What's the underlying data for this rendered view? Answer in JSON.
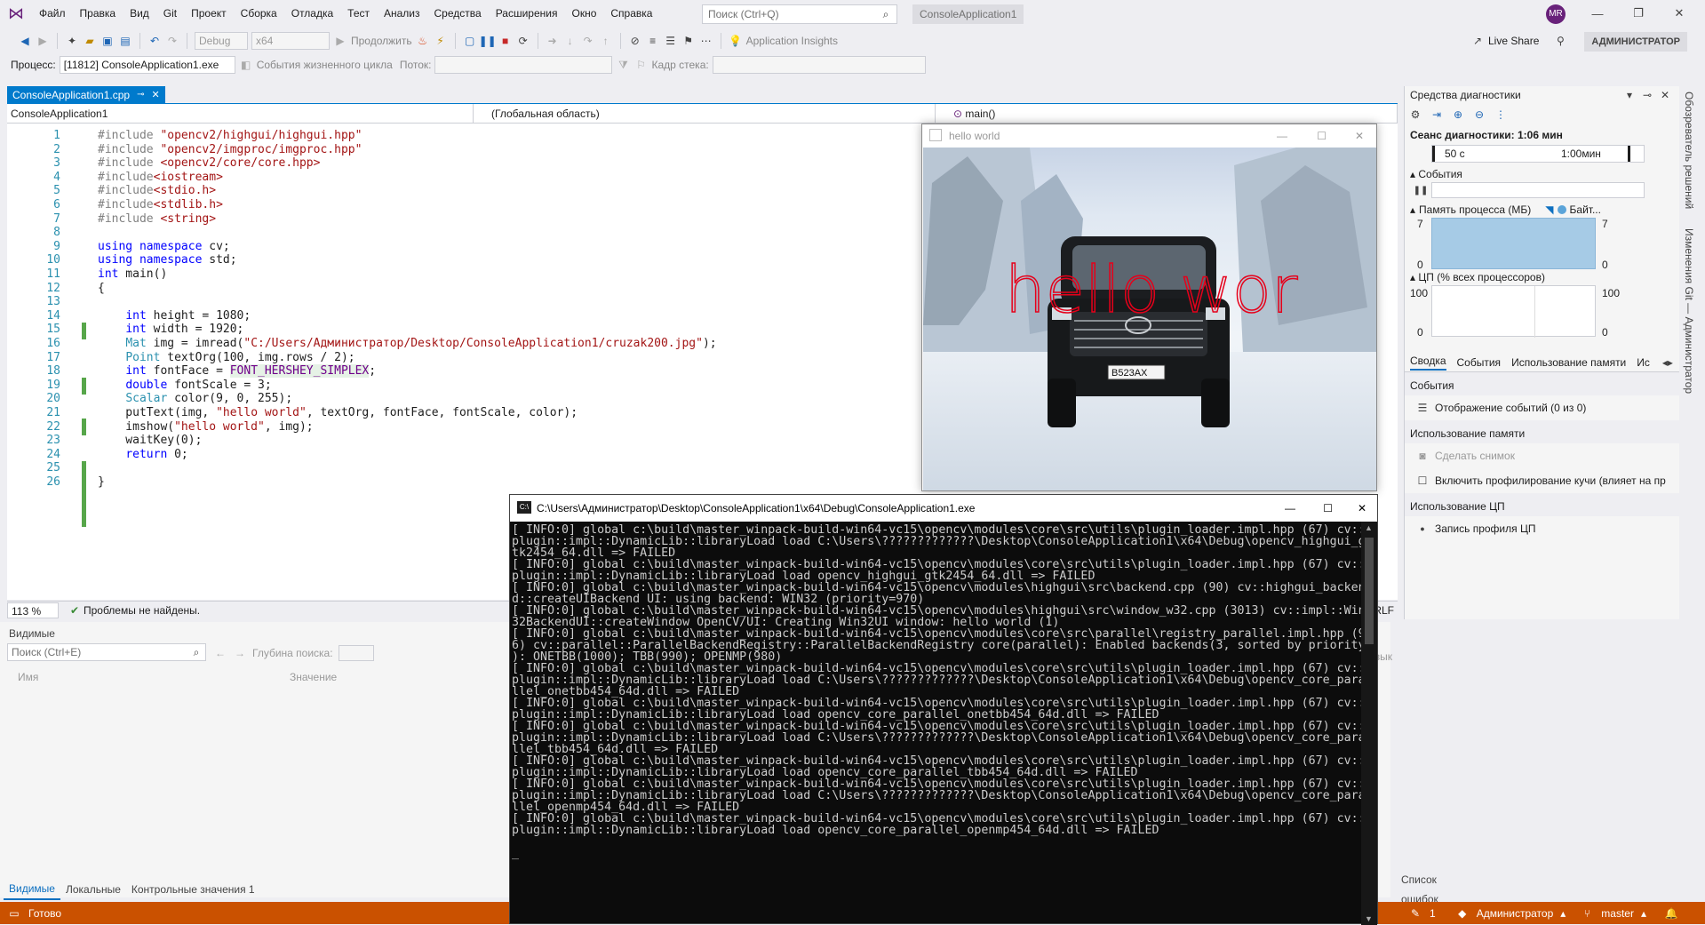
{
  "menubar": {
    "items": [
      "Файл",
      "Правка",
      "Вид",
      "Git",
      "Проект",
      "Сборка",
      "Отладка",
      "Тест",
      "Анализ",
      "Средства",
      "Расширения",
      "Окно",
      "Справка"
    ],
    "search_placeholder": "Поиск (Ctrl+Q)",
    "solution_name": "ConsoleApplication1",
    "avatar": "MR"
  },
  "toolbar": {
    "config": "Debug",
    "platform": "x64",
    "continue_label": "Продолжить",
    "app_insights": "Application Insights",
    "live_share": "Live Share",
    "admin": "АДМИНИСТРАТОР"
  },
  "debug_toolbar": {
    "process_label": "Процесс:",
    "process_value": "[11812] ConsoleApplication1.exe",
    "lifecycle_label": "События жизненного цикла",
    "thread_label": "Поток:",
    "stack_label": "Кадр стека:"
  },
  "editor": {
    "tab_label": "ConsoleApplication1.cpp",
    "nav_project": "ConsoleApplication1",
    "nav_scope": "(Глобальная область)",
    "nav_member": "main()",
    "zoom": "113 %",
    "issues": "Проблемы не найдены.",
    "line_ending": "RLF"
  },
  "code_lines": [
    "#include \"opencv2/highgui/highgui.hpp\"",
    "#include \"opencv2/imgproc/imgproc.hpp\"",
    "#include <opencv2/core/core.hpp>",
    "#include<iostream>",
    "#include<stdio.h>",
    "#include<stdlib.h>",
    "#include <string>",
    "",
    "using namespace cv;",
    "using namespace std;",
    "int main()",
    "{",
    "",
    "    int height = 1080;",
    "    int width = 1920;",
    "    Mat img = imread(\"C:/Users/Администратор/Desktop/ConsoleApplication1/cruzak200.jpg\");",
    "    Point textOrg(100, img.rows / 2);",
    "    int fontFace = FONT_HERSHEY_SIMPLEX;",
    "    double fontScale = 3;",
    "    Scalar color(9, 0, 255);",
    "    putText(img, \"hello world\", textOrg, fontFace, fontScale, color);",
    "    imshow(\"hello world\", img);",
    "    waitKey(0);",
    "    return 0;",
    "",
    "}"
  ],
  "watch": {
    "title": "Видимые",
    "search_placeholder": "Поиск (Ctrl+E)",
    "depth_label": "Глубина поиска:",
    "col_name": "Имя",
    "col_value": "Значение",
    "col_lang": "Язык",
    "tabs": [
      "Видимые",
      "Локальные",
      "Контрольные значения 1"
    ],
    "error_list": "Список ошибок"
  },
  "diagnostics": {
    "title": "Средства диагностики",
    "session": "Сеанс диагностики: 1:06 мин",
    "tick_50": "50 с",
    "tick_100": "1:00мин",
    "events": "События",
    "memory": "Память процесса (МБ)",
    "memory_legend": "Байт...",
    "mem_max": "7",
    "mem_min": "0",
    "cpu": "ЦП (% всех процессоров)",
    "cpu_max": "100",
    "cpu_min": "0",
    "tabs": [
      "Сводка",
      "События",
      "Использование памяти",
      "Ис"
    ],
    "sec_events": "События",
    "show_events": "Отображение событий (0 из 0)",
    "sec_memory": "Использование памяти",
    "snapshot": "Сделать снимок",
    "heap_profiling": "Включить профилирование кучи (влияет на пр",
    "sec_cpu": "Использование ЦП",
    "cpu_profile": "Запись профиля ЦП"
  },
  "vertical_tabs": [
    "Обозреватель решений",
    "Изменения Git — Администратор"
  ],
  "image_window": {
    "title": "hello world",
    "overlay_text": "hello wor",
    "plate": "В523АХ"
  },
  "console": {
    "title": "C:\\Users\\Администратор\\Desktop\\ConsoleApplication1\\x64\\Debug\\ConsoleApplication1.exe",
    "lines": [
      "[ INFO:0] global c:\\build\\master_winpack-build-win64-vc15\\opencv\\modules\\core\\src\\utils\\plugin_loader.impl.hpp (67) cv::",
      "plugin::impl::DynamicLib::libraryLoad load C:\\Users\\?????????????\\Desktop\\ConsoleApplication1\\x64\\Debug\\opencv_highgui_g",
      "tk2454_64.dll => FAILED",
      "[ INFO:0] global c:\\build\\master_winpack-build-win64-vc15\\opencv\\modules\\core\\src\\utils\\plugin_loader.impl.hpp (67) cv::",
      "plugin::impl::DynamicLib::libraryLoad load opencv_highgui_gtk2454_64.dll => FAILED",
      "[ INFO:0] global c:\\build\\master_winpack-build-win64-vc15\\opencv\\modules\\highgui\\src\\backend.cpp (90) cv::highgui_backen",
      "d::createUIBackend UI: using backend: WIN32 (priority=970)",
      "[ INFO:0] global c:\\build\\master_winpack-build-win64-vc15\\opencv\\modules\\highgui\\src\\window_w32.cpp (3013) cv::impl::Win",
      "32BackendUI::createWindow OpenCV/UI: Creating Win32UI window: hello world (1)",
      "[ INFO:0] global c:\\build\\master_winpack-build-win64-vc15\\opencv\\modules\\core\\src\\parallel\\registry_parallel.impl.hpp (9",
      "6) cv::parallel::ParallelBackendRegistry::ParallelBackendRegistry core(parallel): Enabled backends(3, sorted by priority",
      "): ONETBB(1000); TBB(990); OPENMP(980)",
      "[ INFO:0] global c:\\build\\master_winpack-build-win64-vc15\\opencv\\modules\\core\\src\\utils\\plugin_loader.impl.hpp (67) cv::",
      "plugin::impl::DynamicLib::libraryLoad load C:\\Users\\?????????????\\Desktop\\ConsoleApplication1\\x64\\Debug\\opencv_core_para",
      "llel_onetbb454_64d.dll => FAILED",
      "[ INFO:0] global c:\\build\\master_winpack-build-win64-vc15\\opencv\\modules\\core\\src\\utils\\plugin_loader.impl.hpp (67) cv::",
      "plugin::impl::DynamicLib::libraryLoad load opencv_core_parallel_onetbb454_64d.dll => FAILED",
      "[ INFO:0] global c:\\build\\master_winpack-build-win64-vc15\\opencv\\modules\\core\\src\\utils\\plugin_loader.impl.hpp (67) cv::",
      "plugin::impl::DynamicLib::libraryLoad load C:\\Users\\?????????????\\Desktop\\ConsoleApplication1\\x64\\Debug\\opencv_core_para",
      "llel_tbb454_64d.dll => FAILED",
      "[ INFO:0] global c:\\build\\master_winpack-build-win64-vc15\\opencv\\modules\\core\\src\\utils\\plugin_loader.impl.hpp (67) cv::",
      "plugin::impl::DynamicLib::libraryLoad load opencv_core_parallel_tbb454_64d.dll => FAILED",
      "[ INFO:0] global c:\\build\\master_winpack-build-win64-vc15\\opencv\\modules\\core\\src\\utils\\plugin_loader.impl.hpp (67) cv::",
      "plugin::impl::DynamicLib::libraryLoad load C:\\Users\\?????????????\\Desktop\\ConsoleApplication1\\x64\\Debug\\opencv_core_para",
      "llel_openmp454_64d.dll => FAILED",
      "[ INFO:0] global c:\\build\\master_winpack-build-win64-vc15\\opencv\\modules\\core\\src\\utils\\plugin_loader.impl.hpp (67) cv::",
      "plugin::impl::DynamicLib::libraryLoad load opencv_core_parallel_openmp454_64d.dll => FAILED",
      "",
      "_"
    ]
  },
  "statusbar": {
    "ready": "Готово",
    "errors": "1",
    "user": "Администратор",
    "branch": "master"
  },
  "colors": {
    "accent": "#007acc",
    "status_bg": "#ca5100",
    "overlay_text": "#e6001a"
  }
}
